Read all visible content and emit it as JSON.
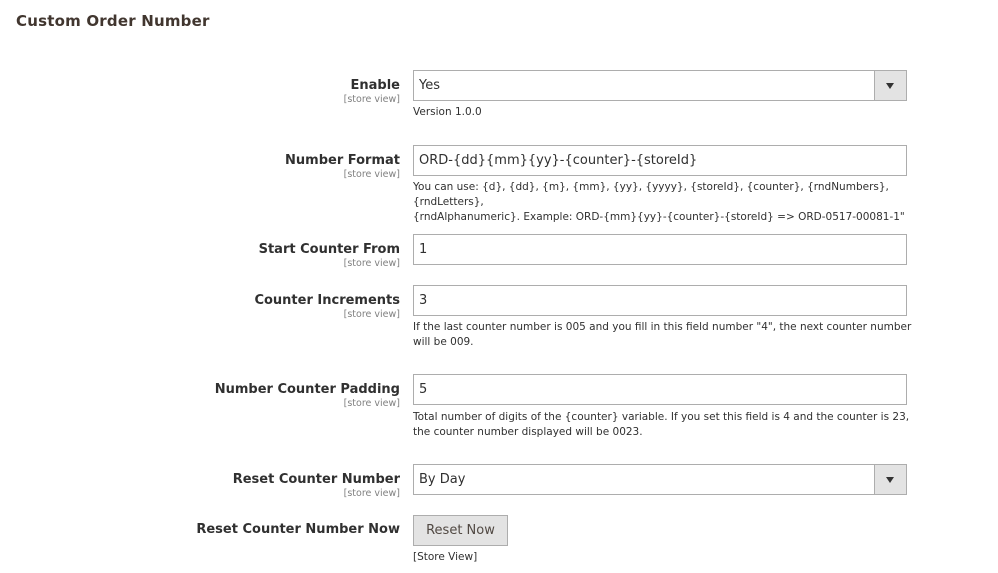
{
  "section": {
    "title": "Custom Order Number"
  },
  "fields": {
    "enable": {
      "label": "Enable",
      "scope": "[store view]",
      "value": "Yes",
      "note": "Version 1.0.0"
    },
    "number_format": {
      "label": "Number Format",
      "scope": "[store view]",
      "value": "ORD-{dd}{mm}{yy}-{counter}-{storeId}",
      "note_line1": "You can use: {d}, {dd}, {m}, {mm}, {yy}, {yyyy}, {storeId}, {counter}, {rndNumbers}, {rndLetters},",
      "note_line2": "{rndAlphanumeric}. Example: ORD-{mm}{yy}-{counter}-{storeId} => ORD-0517-00081-1\""
    },
    "start_counter": {
      "label": "Start Counter From",
      "scope": "[store view]",
      "value": "1"
    },
    "counter_increments": {
      "label": "Counter Increments",
      "scope": "[store view]",
      "value": "3",
      "note_line1": "If the last counter number is 005 and you fill in this field number \"4\", the next counter number",
      "note_line2": "will be 009."
    },
    "counter_padding": {
      "label": "Number Counter Padding",
      "scope": "[store view]",
      "value": "5",
      "note_line1": "Total number of digits of the {counter} variable. If you set this field is 4 and the counter is 23,",
      "note_line2": "the counter number displayed will be 0023."
    },
    "reset_counter": {
      "label": "Reset Counter Number",
      "scope": "[store view]",
      "value": "By Day"
    },
    "reset_now": {
      "label": "Reset Counter Number Now",
      "button": "Reset Now",
      "scope": "[Store View]"
    }
  },
  "icons": {
    "dropdown": "chevron-down-icon"
  },
  "colors": {
    "button_bg": "#e3e3e3",
    "border": "#adadad",
    "text": "#303030",
    "scope_text": "#808080"
  }
}
